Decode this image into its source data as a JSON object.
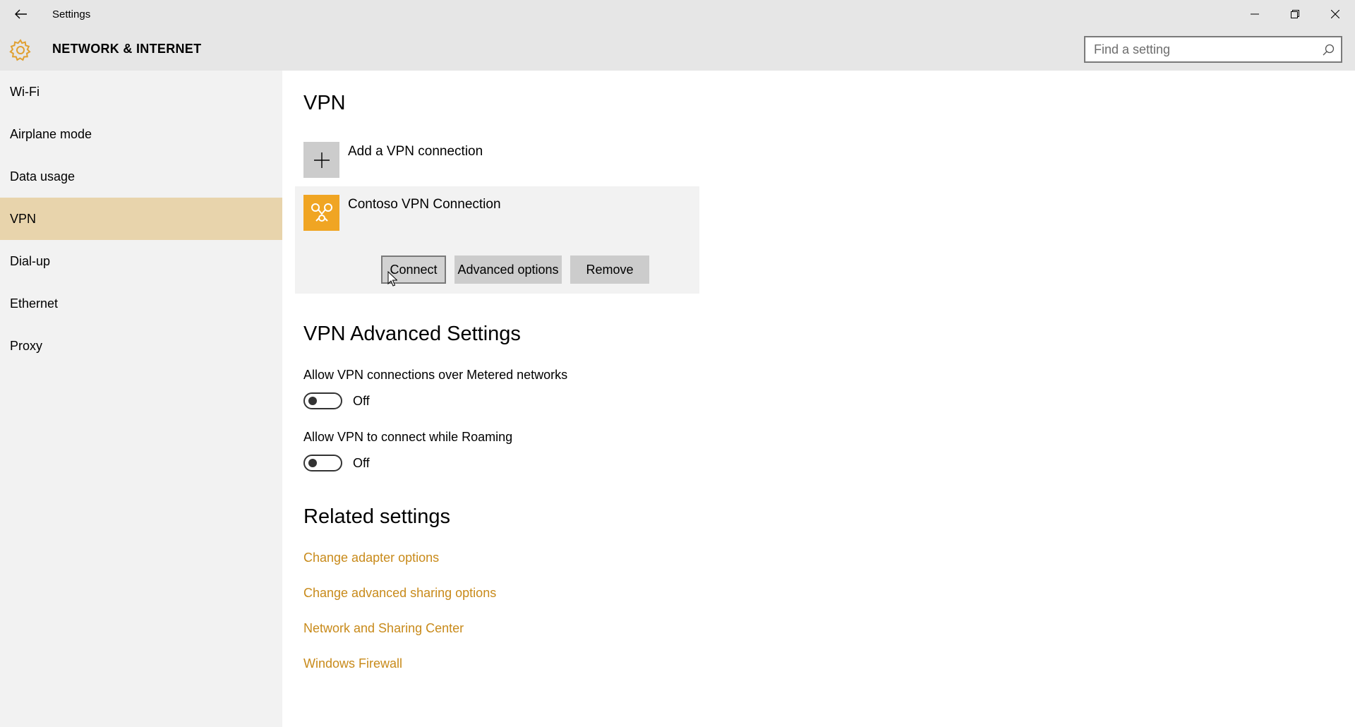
{
  "window": {
    "title": "Settings",
    "back_icon": "arrow-left-icon",
    "controls": [
      "minimize-icon",
      "restore-icon",
      "close-icon"
    ]
  },
  "header": {
    "section_title": "NETWORK & INTERNET",
    "icon": "gear-icon",
    "search_placeholder": "Find a setting"
  },
  "sidebar": {
    "items": [
      {
        "label": "Wi-Fi",
        "active": false
      },
      {
        "label": "Airplane mode",
        "active": false
      },
      {
        "label": "Data usage",
        "active": false
      },
      {
        "label": "VPN",
        "active": true
      },
      {
        "label": "Dial-up",
        "active": false
      },
      {
        "label": "Ethernet",
        "active": false
      },
      {
        "label": "Proxy",
        "active": false
      }
    ]
  },
  "main": {
    "title": "VPN",
    "add_connection_label": "Add a VPN connection",
    "connection": {
      "name": "Contoso VPN Connection",
      "buttons": {
        "connect": "Connect",
        "advanced": "Advanced options",
        "remove": "Remove"
      }
    },
    "advanced_title": "VPN Advanced Settings",
    "settings": [
      {
        "label": "Allow VPN connections over Metered networks",
        "state": "Off"
      },
      {
        "label": "Allow VPN to connect while Roaming",
        "state": "Off"
      }
    ],
    "related_title": "Related settings",
    "related_links": [
      "Change adapter options",
      "Change advanced sharing options",
      "Network and Sharing Center",
      "Windows Firewall"
    ]
  },
  "colors": {
    "chrome_bg": "#e6e6e6",
    "sidebar_bg": "#f2f2f2",
    "active_nav": "#e8d4ac",
    "accent": "#c88a1a",
    "vpn_logo": "#f0a523"
  }
}
